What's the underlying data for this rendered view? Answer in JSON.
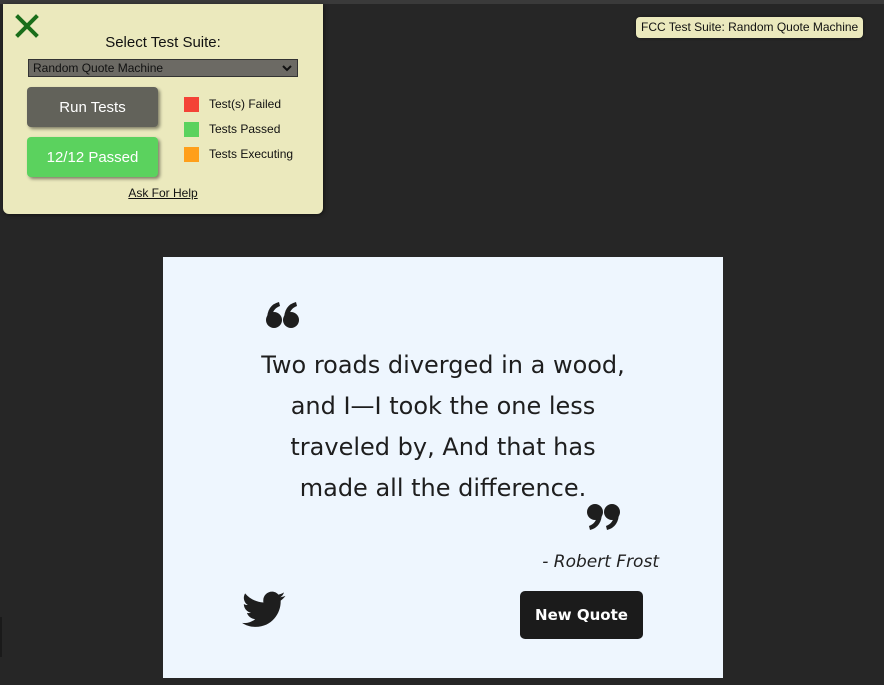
{
  "test_suite": {
    "close_icon": "close-x-icon",
    "label": "Select Test Suite:",
    "selected_suite": "Random Quote Machine",
    "run_button": "Run Tests",
    "passed_button": "12/12 Passed",
    "legend": [
      {
        "label": "Test(s) Failed",
        "color": "#f44336"
      },
      {
        "label": "Tests Passed",
        "color": "#5bd25e"
      },
      {
        "label": "Tests Executing",
        "color": "#ff9f1a"
      }
    ],
    "help_link": "Ask For Help"
  },
  "badge": {
    "label": "FCC Test Suite: Random Quote Machine"
  },
  "quote": {
    "text": "Two roads diverged in a wood, and I—I took the one less traveled by, And that has made all the difference.",
    "author": "- Robert Frost",
    "open_icon": "open-quote-icon",
    "close_icon": "close-quote-icon",
    "tweet_icon": "twitter-icon",
    "new_quote_button": "New Quote"
  },
  "colors": {
    "background": "#262626",
    "panel": "#ebe9bd",
    "quote_box": "#eef6fe",
    "button_dark": "#1b1b1b"
  }
}
